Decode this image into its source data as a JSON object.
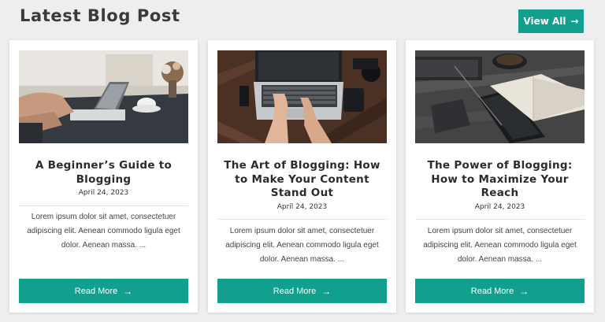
{
  "header": {
    "title": "Latest Blog Post",
    "view_all_label": "View All",
    "view_all_arrow": "→"
  },
  "colors": {
    "accent": "#12a08e",
    "background": "#eeeeee",
    "card": "#ffffff"
  },
  "posts": [
    {
      "title": "A Beginner’s Guide to Blogging",
      "date": "April 24, 2023",
      "excerpt": "Lorem ipsum dolor sit amet, consectetuer adipiscing elit. Aenean commodo ligula eget dolor. Aenean massa. ...",
      "button_label": "Read More",
      "button_arrow": "→",
      "image": "laptop-coffee-desk-photo"
    },
    {
      "title": "The Art of Blogging: How to Make Your Content Stand Out",
      "date": "April 24, 2023",
      "excerpt": "Lorem ipsum dolor sit amet, consectetuer adipiscing elit. Aenean commodo ligula eget dolor. Aenean massa. ...",
      "button_label": "Read More",
      "button_arrow": "→",
      "image": "typing-on-laptop-photo"
    },
    {
      "title": "The Power of Blogging: How to Maximize Your Reach",
      "date": "April 24, 2023",
      "excerpt": "Lorem ipsum dolor sit amet, consectetuer adipiscing elit. Aenean commodo ligula eget dolor. Aenean massa. ...",
      "button_label": "Read More",
      "button_arrow": "→",
      "image": "notebook-tablet-coffee-photo"
    }
  ]
}
